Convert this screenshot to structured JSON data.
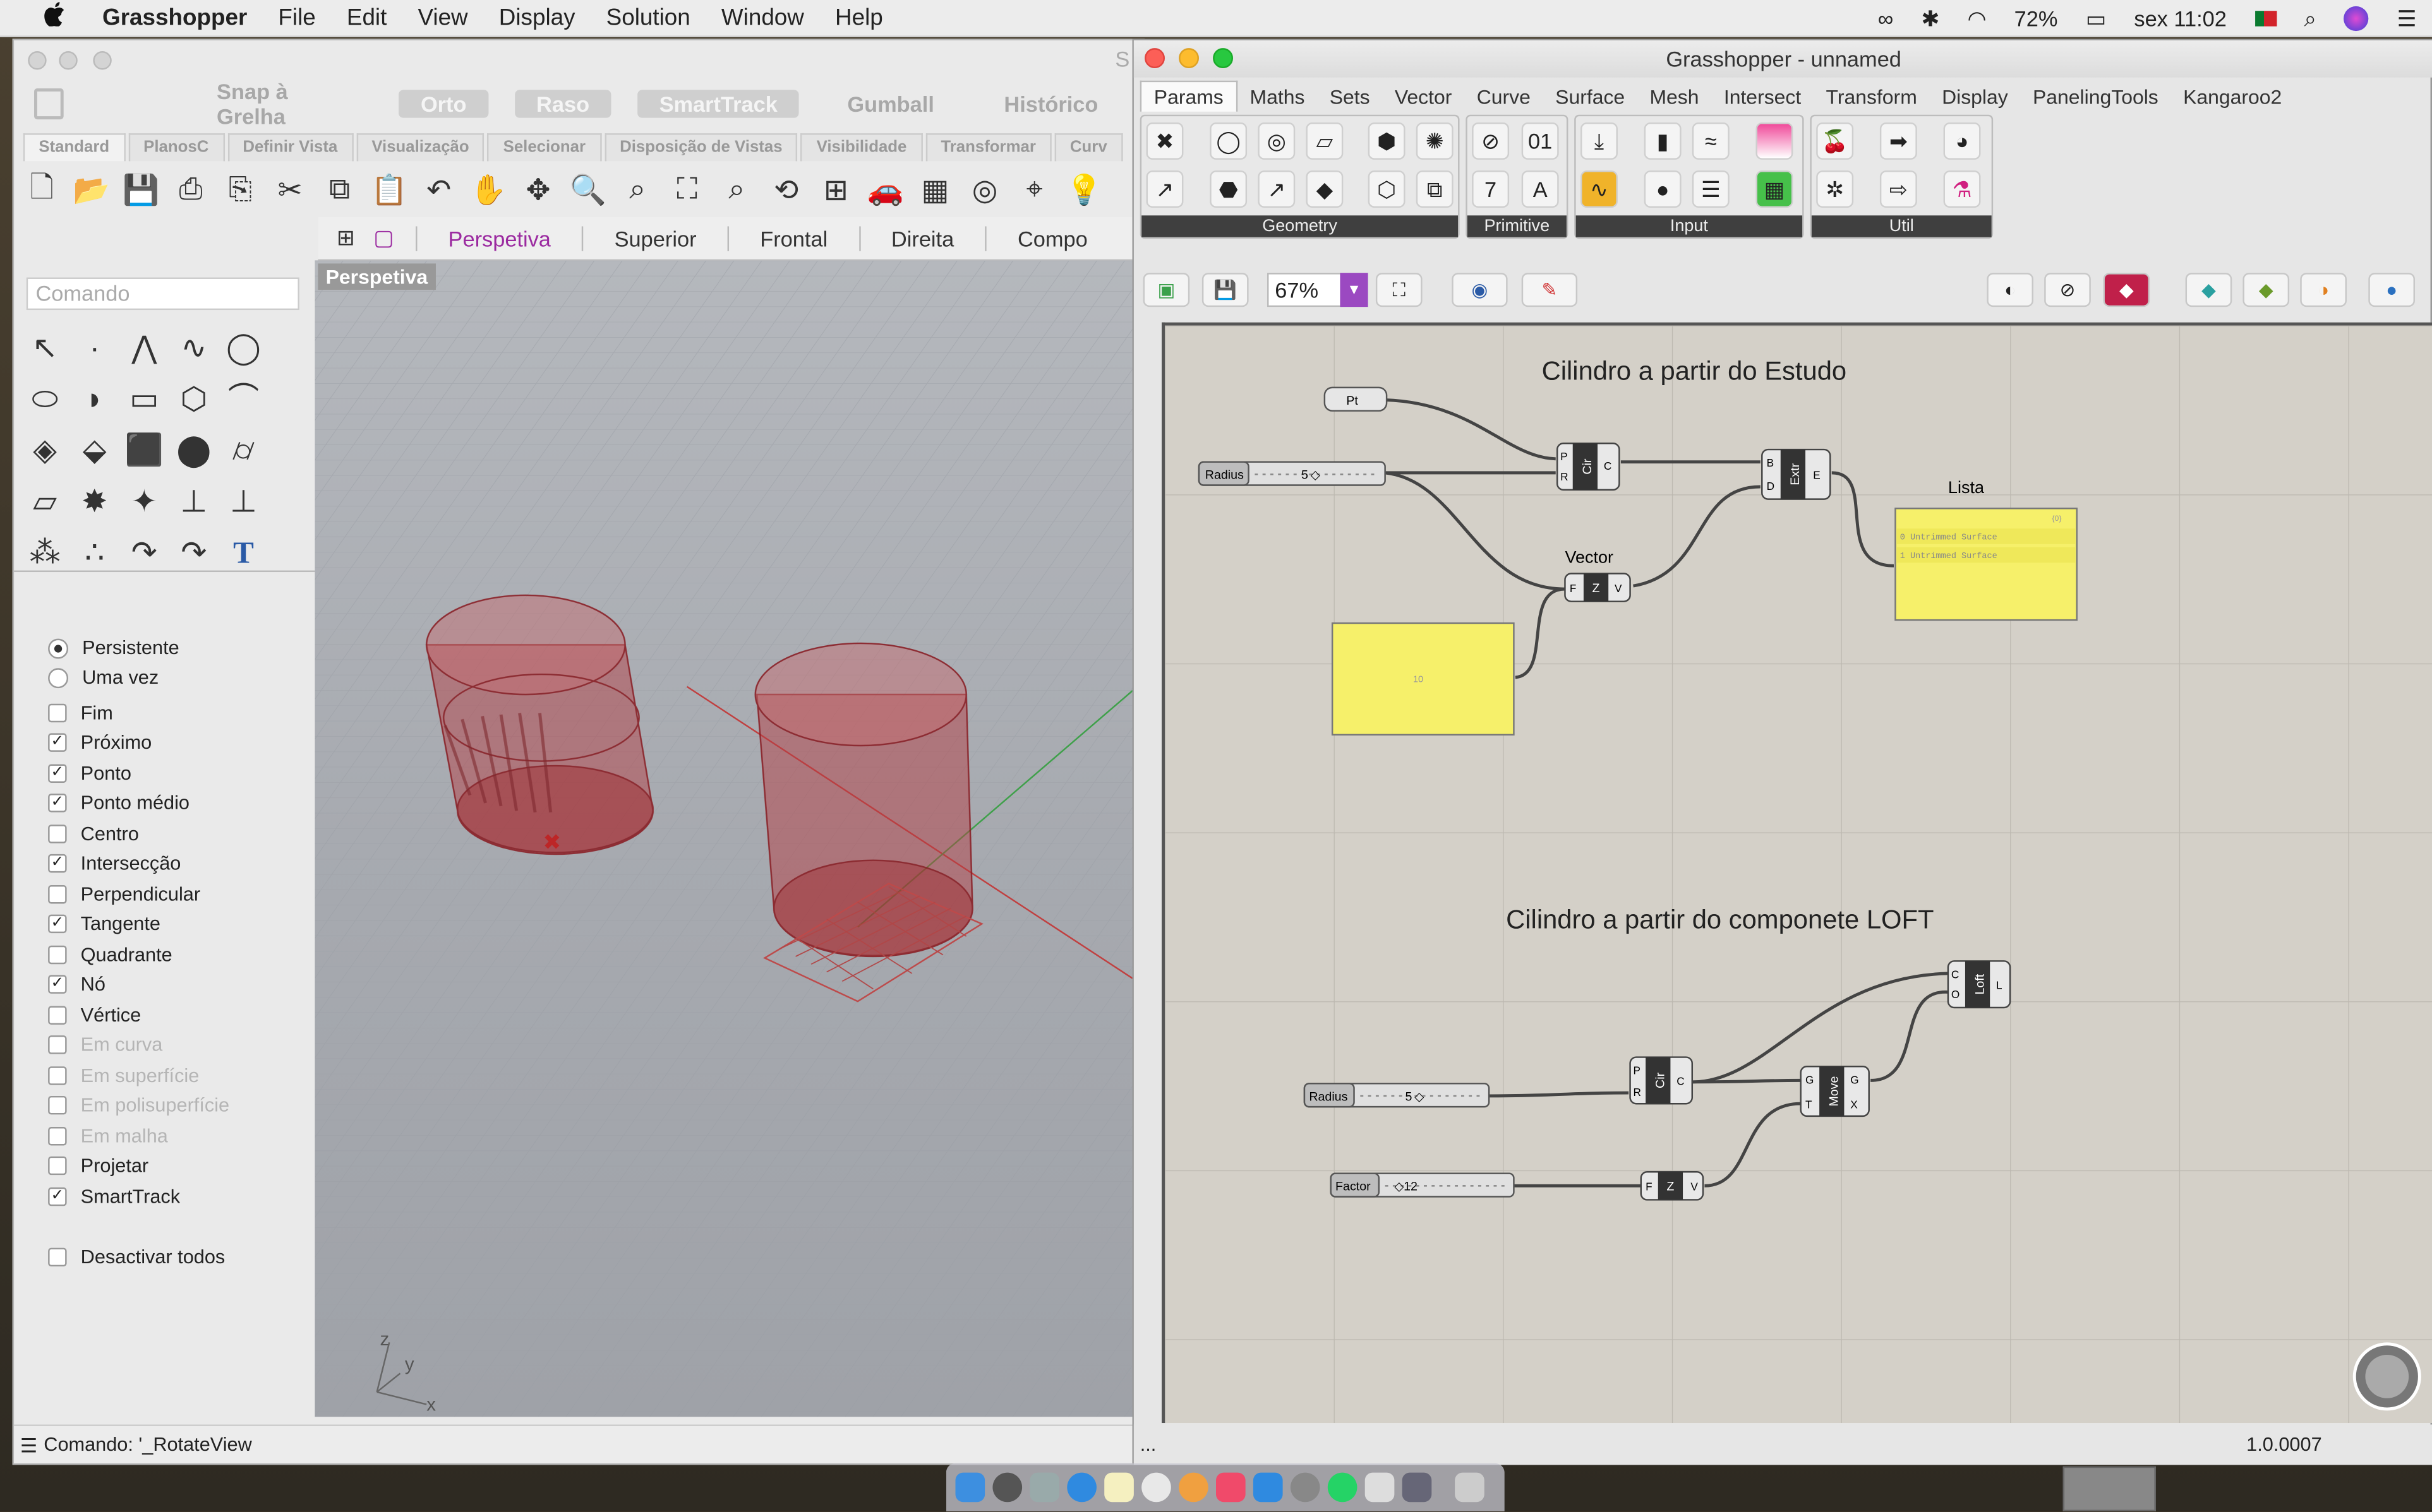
{
  "menubar": {
    "apple": "",
    "items": [
      "Grasshopper",
      "File",
      "Edit",
      "View",
      "Display",
      "Solution",
      "Window",
      "Help"
    ],
    "battery": "72%",
    "clock": "sex 11:02"
  },
  "rhino": {
    "title_partial": "S",
    "bar1": {
      "snap": "Snap à Grelha",
      "orto": "Orto",
      "raso": "Raso",
      "smarttrack": "SmartTrack",
      "gumball": "Gumball",
      "historico": "Histórico"
    },
    "tabs": [
      "Standard",
      "PlanosC",
      "Definir Vista",
      "Visualização",
      "Selecionar",
      "Disposição de Vistas",
      "Visibilidade",
      "Transformar",
      "Curv"
    ],
    "viewport_tabs": [
      "Perspetiva",
      "Superior",
      "Frontal",
      "Direita",
      "Compo"
    ],
    "command_placeholder": "Comando",
    "viewport_label": "Perspetiva",
    "axes": {
      "z": "z",
      "y": "y",
      "x": "x"
    },
    "osnap": [
      {
        "label": "Persistente",
        "type": "radio",
        "checked": true,
        "disabled": false
      },
      {
        "label": "Uma vez",
        "type": "radio",
        "checked": false,
        "disabled": false
      },
      {
        "label": "Fim",
        "type": "check",
        "checked": false,
        "disabled": false
      },
      {
        "label": "Próximo",
        "type": "check",
        "checked": true,
        "disabled": false
      },
      {
        "label": "Ponto",
        "type": "check",
        "checked": true,
        "disabled": false
      },
      {
        "label": "Ponto médio",
        "type": "check",
        "checked": true,
        "disabled": false
      },
      {
        "label": "Centro",
        "type": "check",
        "checked": false,
        "disabled": false
      },
      {
        "label": "Intersecção",
        "type": "check",
        "checked": true,
        "disabled": false
      },
      {
        "label": "Perpendicular",
        "type": "check",
        "checked": false,
        "disabled": false
      },
      {
        "label": "Tangente",
        "type": "check",
        "checked": true,
        "disabled": false
      },
      {
        "label": "Quadrante",
        "type": "check",
        "checked": false,
        "disabled": false
      },
      {
        "label": "Nó",
        "type": "check",
        "checked": true,
        "disabled": false
      },
      {
        "label": "Vértice",
        "type": "check",
        "checked": false,
        "disabled": false
      },
      {
        "label": "Em curva",
        "type": "check",
        "checked": false,
        "disabled": true
      },
      {
        "label": "Em superfície",
        "type": "check",
        "checked": false,
        "disabled": true
      },
      {
        "label": "Em polisuperfície",
        "type": "check",
        "checked": false,
        "disabled": true
      },
      {
        "label": "Em malha",
        "type": "check",
        "checked": false,
        "disabled": true
      },
      {
        "label": "Projetar",
        "type": "check",
        "checked": false,
        "disabled": false
      },
      {
        "label": "SmartTrack",
        "type": "check",
        "checked": true,
        "disabled": false
      },
      {
        "label": "Desactivar todos",
        "type": "check",
        "checked": false,
        "disabled": false
      }
    ],
    "status": "Comando: '_RotateView"
  },
  "gh": {
    "title": "Grasshopper - unnamed",
    "tabs": [
      "Params",
      "Maths",
      "Sets",
      "Vector",
      "Curve",
      "Surface",
      "Mesh",
      "Intersect",
      "Transform",
      "Display",
      "PanelingTools",
      "Kangaroo2"
    ],
    "panels": {
      "geometry": "Geometry",
      "primitive": "Primitive",
      "input": "Input",
      "util": "Util"
    },
    "zoom": "67%",
    "canvas": {
      "title1": "Cilindro a partir do Estudo",
      "title2": "Cilindro a partir do componete LOFT",
      "pt": "Pt",
      "radius1": {
        "label": "Radius",
        "value": "5"
      },
      "radius2": {
        "label": "Radius",
        "value": "5"
      },
      "factor": {
        "label": "Factor",
        "value": "12"
      },
      "cir": "Cir",
      "extr": "Extr",
      "z": "Z",
      "move": "Move",
      "loft": "Loft",
      "vector_label": "Vector",
      "lista_label": "Lista",
      "panel_value": "10",
      "lista": {
        "count": "{0}",
        "items": [
          "0 Untrimmed Surface",
          "1 Untrimmed Surface"
        ]
      },
      "ports": {
        "P": "P",
        "R": "R",
        "C": "C",
        "B": "B",
        "D": "D",
        "E": "E",
        "F": "F",
        "V": "V",
        "G": "G",
        "T": "T",
        "X": "X",
        "O": "O",
        "L": "L"
      }
    },
    "status_left": "...",
    "version": "1.0.0007"
  },
  "colors": {
    "accent_purple": "#9b2aa0",
    "panel_yellow": "#f6f06a",
    "cylinder_red": "#b2262b"
  }
}
